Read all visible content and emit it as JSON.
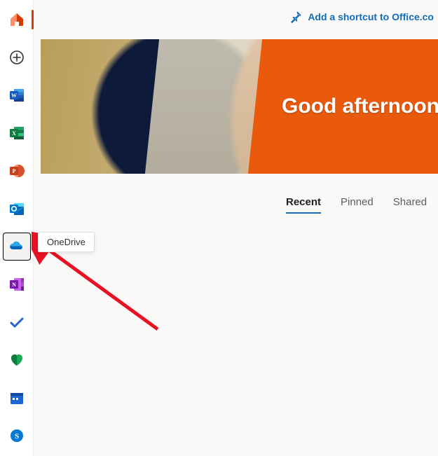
{
  "topbar": {
    "shortcut_label": "Add a shortcut to Office.co"
  },
  "hero": {
    "greeting": "Good afternoon"
  },
  "tabs": {
    "recent": "Recent",
    "pinned": "Pinned",
    "shared": "Shared"
  },
  "sidebar": {
    "items": [
      {
        "name": "home"
      },
      {
        "name": "create"
      },
      {
        "name": "word"
      },
      {
        "name": "excel"
      },
      {
        "name": "powerpoint"
      },
      {
        "name": "outlook"
      },
      {
        "name": "onedrive"
      },
      {
        "name": "onenote"
      },
      {
        "name": "todo"
      },
      {
        "name": "family-safety"
      },
      {
        "name": "calendar"
      },
      {
        "name": "skype"
      }
    ]
  },
  "tooltip": {
    "onedrive": "OneDrive"
  }
}
